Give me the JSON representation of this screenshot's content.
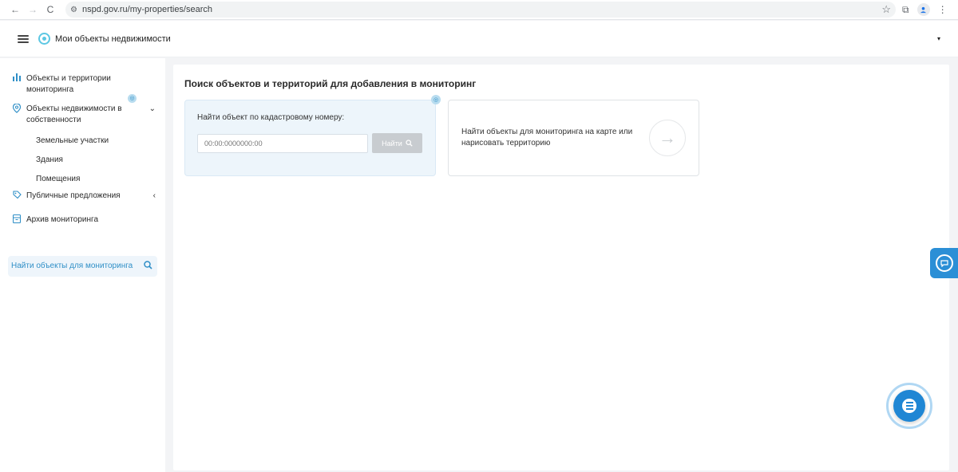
{
  "browser": {
    "url": "nspd.gov.ru/my-properties/search",
    "back_icon": "←",
    "forward_icon": "→",
    "reload_icon": "C",
    "star_icon": "☆",
    "extensions_icon": "⧉",
    "menu_icon": "⋮"
  },
  "header": {
    "title": "Мои объекты недвижимости",
    "caret_icon": "▾"
  },
  "sidebar": {
    "items": [
      {
        "label": "Объекты и территории мониторинга",
        "icon": "bar-chart-icon"
      },
      {
        "label": "Объекты недвижимости в собственности",
        "icon": "location-pin-icon",
        "chevron": "⌄",
        "badge": "◎"
      },
      {
        "label": "Публичные предложения",
        "icon": "tag-icon",
        "chevron": "‹"
      },
      {
        "label": "Архив мониторинга",
        "icon": "archive-icon"
      }
    ],
    "sub_items": [
      "Земельные участки",
      "Здания",
      "Помещения"
    ],
    "search_block": {
      "label": "Найти объекты для мониторинга"
    }
  },
  "main": {
    "title": "Поиск объектов и территорий для добавления в мониторинг",
    "cadastral_card": {
      "label": "Найти объект по кадастровому номеру:",
      "placeholder": "00:00:0000000:00",
      "button_label": "Найти",
      "badge": "◎"
    },
    "map_card": {
      "text": "Найти объекты для мониторинга на карте или нарисовать территорию",
      "arrow": "→"
    }
  },
  "colors": {
    "accent": "#2f8fc7",
    "fab": "#1f86d4",
    "card_bg": "#edf5fb",
    "button_disabled": "#c8ccd0"
  }
}
